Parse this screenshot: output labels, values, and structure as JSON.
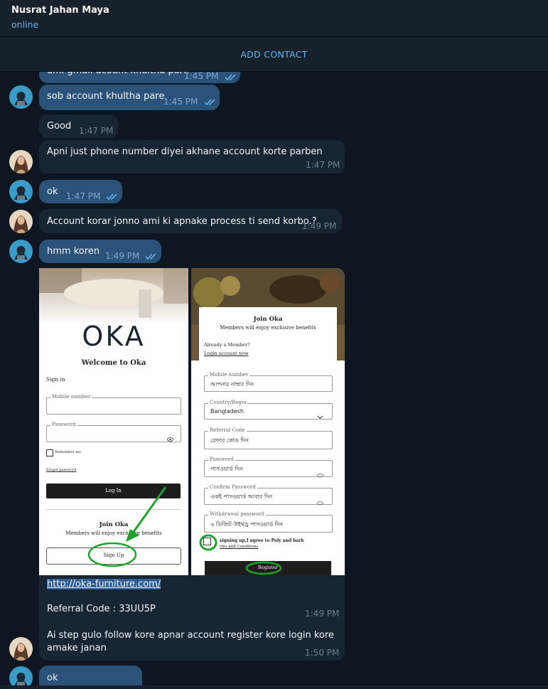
{
  "header": {
    "contact_name": "Nusrat Jahan Maya",
    "status": "online"
  },
  "add_contact": {
    "label": "ADD CONTACT"
  },
  "colors": {
    "background": "#0e1621",
    "header_bg": "#17212b",
    "outgoing_bubble": "#2b5278",
    "incoming_bubble": "#182533",
    "accent": "#6ab2f2",
    "annotation_green": "#1fa22d"
  },
  "messages": [
    {
      "text": "ami gmail acount khultha pare",
      "time": "1:45 PM"
    },
    {
      "text": "sob account khultha pare",
      "time": "1:45 PM"
    },
    {
      "text": "Good",
      "time": "1:47 PM"
    },
    {
      "text": "Apni just phone number diyei akhane account korte parben",
      "time": "1:47 PM"
    },
    {
      "text": "ok",
      "time": "1:47 PM"
    },
    {
      "text": "Account korar jonno ami ki apnake process ti send korbo.?",
      "time": "1:49 PM"
    },
    {
      "text": "hmm koren",
      "time": "1:49 PM"
    },
    {
      "text": "Ai step gulo follow kore apnar account register kore login kore",
      "text2": "amake janan",
      "time": "1:50 PM"
    },
    {
      "text": "ok"
    }
  ],
  "link_message": {
    "url": "http://oka-furniture.com/",
    "referral": "Referral Code :  33UU5P",
    "time": "1:49 PM"
  },
  "screenshot_left": {
    "logo": "OKA",
    "welcome": "Welcome to Oka",
    "sign_in": "Sign in",
    "mobile_label": "Mobile number",
    "password_label": "Password",
    "remember": "Remember me",
    "forgot": "Forgot password",
    "login_btn": "Log In",
    "join_title": "Join Oka",
    "join_sub": "Members will enjoy exclusive benefits",
    "signup_btn": "Sign Up"
  },
  "screenshot_right": {
    "join_title": "Join Oka",
    "join_sub": "Members will enjoy exclusive benefits",
    "already": "Already a Member?",
    "login_link": "Login account now",
    "mobile_label": "Mobile number",
    "mobile_value": "আপনার নাম্বার দিন",
    "country_label": "Country/Regio",
    "country_value": "Bangladesh",
    "referral_label": "Referral Code",
    "referral_value": "রেফার কোড দিন",
    "password_label": "Password",
    "password_value": "পাসওয়ার্ড দিন",
    "confirm_label": "Confirm Password",
    "confirm_value": "একই পাসওয়ার্ড আবার দিন",
    "withdraw_label": "Withdrawal password",
    "withdraw_value": "৬ ডিজিট উইথড্র পাসওয়ার্ড দিন",
    "agree": "signing up,I agree to Poly and bark",
    "terms": "rms and Conditions",
    "register_btn": "Register"
  }
}
